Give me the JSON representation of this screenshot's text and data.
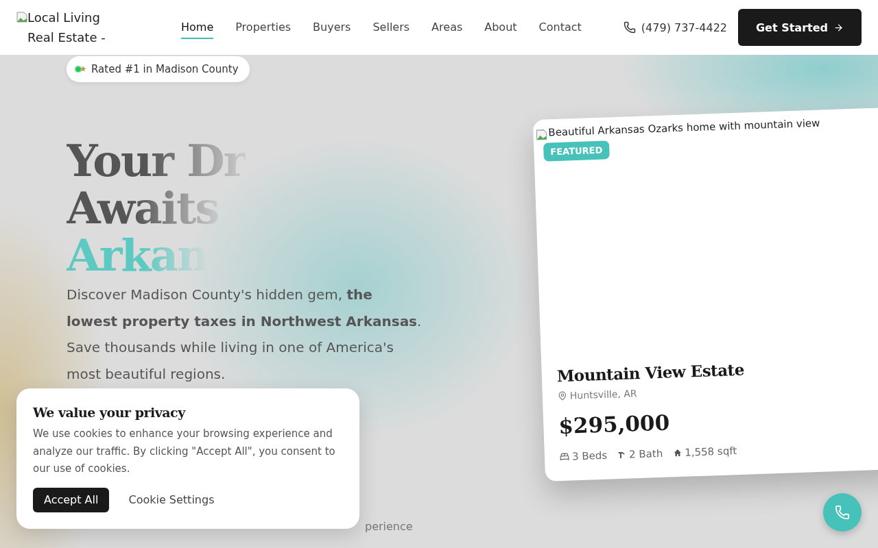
{
  "header": {
    "logo_alt": "Local Living Real Estate -",
    "nav": [
      {
        "label": "Home",
        "selected": true
      },
      {
        "label": "Properties",
        "selected": false
      },
      {
        "label": "Buyers",
        "selected": false
      },
      {
        "label": "Sellers",
        "selected": false
      },
      {
        "label": "Areas",
        "selected": false
      },
      {
        "label": "About",
        "selected": false
      },
      {
        "label": "Contact",
        "selected": false
      }
    ],
    "phone": "(479) 737-4422",
    "cta": "Get Started"
  },
  "hero": {
    "badge": "Rated #1 in Madison County",
    "headline": [
      "Your Dr",
      "Awaits",
      "Arkan"
    ],
    "intro": "Discover Madison County's hidden gem, **the lowest property taxes in Northwest Arkansas**. Save thousands while living in one of America's most beautiful regions.",
    "note": "perience"
  },
  "featured_card": {
    "image_alt": "Beautiful Arkansas Ozarks home with mountain view",
    "tag": "FEATURED",
    "title": "Mountain View Estate",
    "location": "Huntsville, AR",
    "price": "$295,000",
    "specs": [
      {
        "kind": "beds",
        "text": "3 Beds"
      },
      {
        "kind": "bath",
        "text": "2 Bath"
      },
      {
        "kind": "area",
        "text": "1,558 sqft"
      }
    ]
  },
  "cookie_banner": {
    "title": "We value your privacy",
    "text": "We use cookies to enhance your browsing experience and analyze our traffic. By clicking \"Accept All\", you consent to our use of cookies.",
    "buttons": [
      {
        "kind": "primary",
        "label": "Accept All"
      },
      {
        "kind": "plain",
        "label": "Cookie Settings"
      }
    ]
  }
}
